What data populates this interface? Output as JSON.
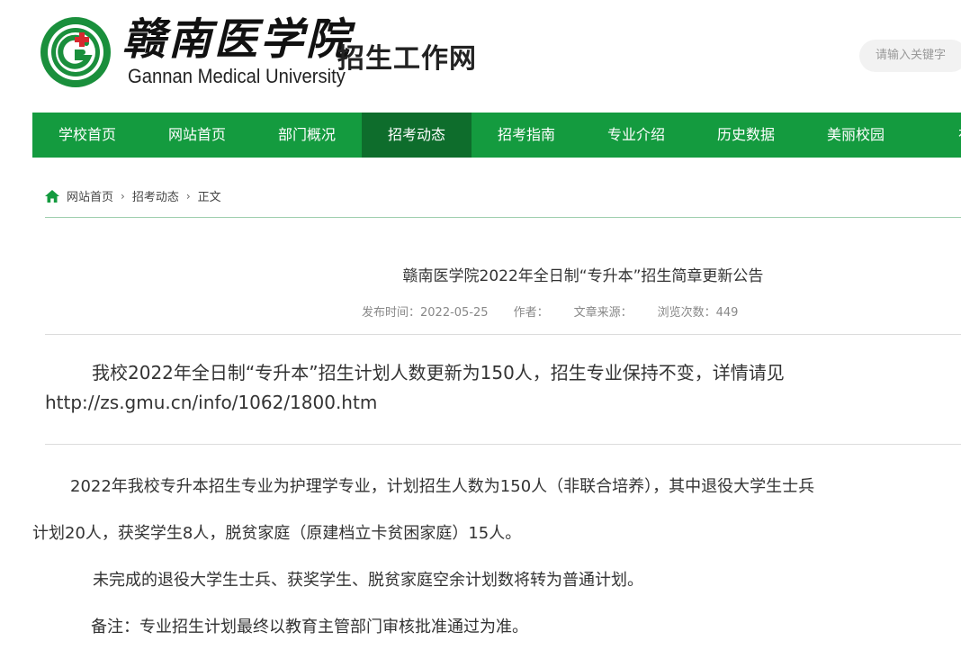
{
  "header": {
    "logo_cn": "赣南医学院",
    "logo_en": "Gannan Medical University",
    "site_name": "招生工作网",
    "search_placeholder": "请输入关键字"
  },
  "nav": {
    "items": [
      {
        "label": "学校首页",
        "active": false
      },
      {
        "label": "网站首页",
        "active": false
      },
      {
        "label": "部门概况",
        "active": false
      },
      {
        "label": "招考动态",
        "active": true
      },
      {
        "label": "招考指南",
        "active": false
      },
      {
        "label": "专业介绍",
        "active": false
      },
      {
        "label": "历史数据",
        "active": false
      },
      {
        "label": "美丽校园",
        "active": false
      },
      {
        "label": "在",
        "active": false
      }
    ]
  },
  "breadcrumb": {
    "home": "网站首页",
    "section": "招考动态",
    "current": "正文"
  },
  "article": {
    "title": "赣南医学院2022年全日制“专升本”招生简章更新公告",
    "meta": {
      "publish_time": "发布时间：2022-05-25",
      "author": "作者：",
      "source": "文章来源：",
      "views": "浏览次数：449"
    },
    "notice_text": "我校2022年全日制“专升本”招生计划人数更新为150人，招生专业保持不变，详情请见",
    "notice_link": "http://zs.gmu.cn/info/1062/1800.htm",
    "para1_line1": "2022年我校专升本招生专业为护理学专业，计划招生人数为150人（非联合培养），其中退役大学生士兵",
    "para1_line2": "计划20人，获奖学生8人，脱贫家庭（原建档立卡贫困家庭）15人。",
    "para2": "未完成的退役大学生士兵、获奖学生、脱贫家庭空余计划数将转为普通计划。",
    "para3": "备注：专业招生计划最终以教育主管部门审核批准通过为准。"
  },
  "colors": {
    "nav_green": "#149b3f",
    "nav_active": "#0e6d2c",
    "brand_red": "#d7282f"
  }
}
